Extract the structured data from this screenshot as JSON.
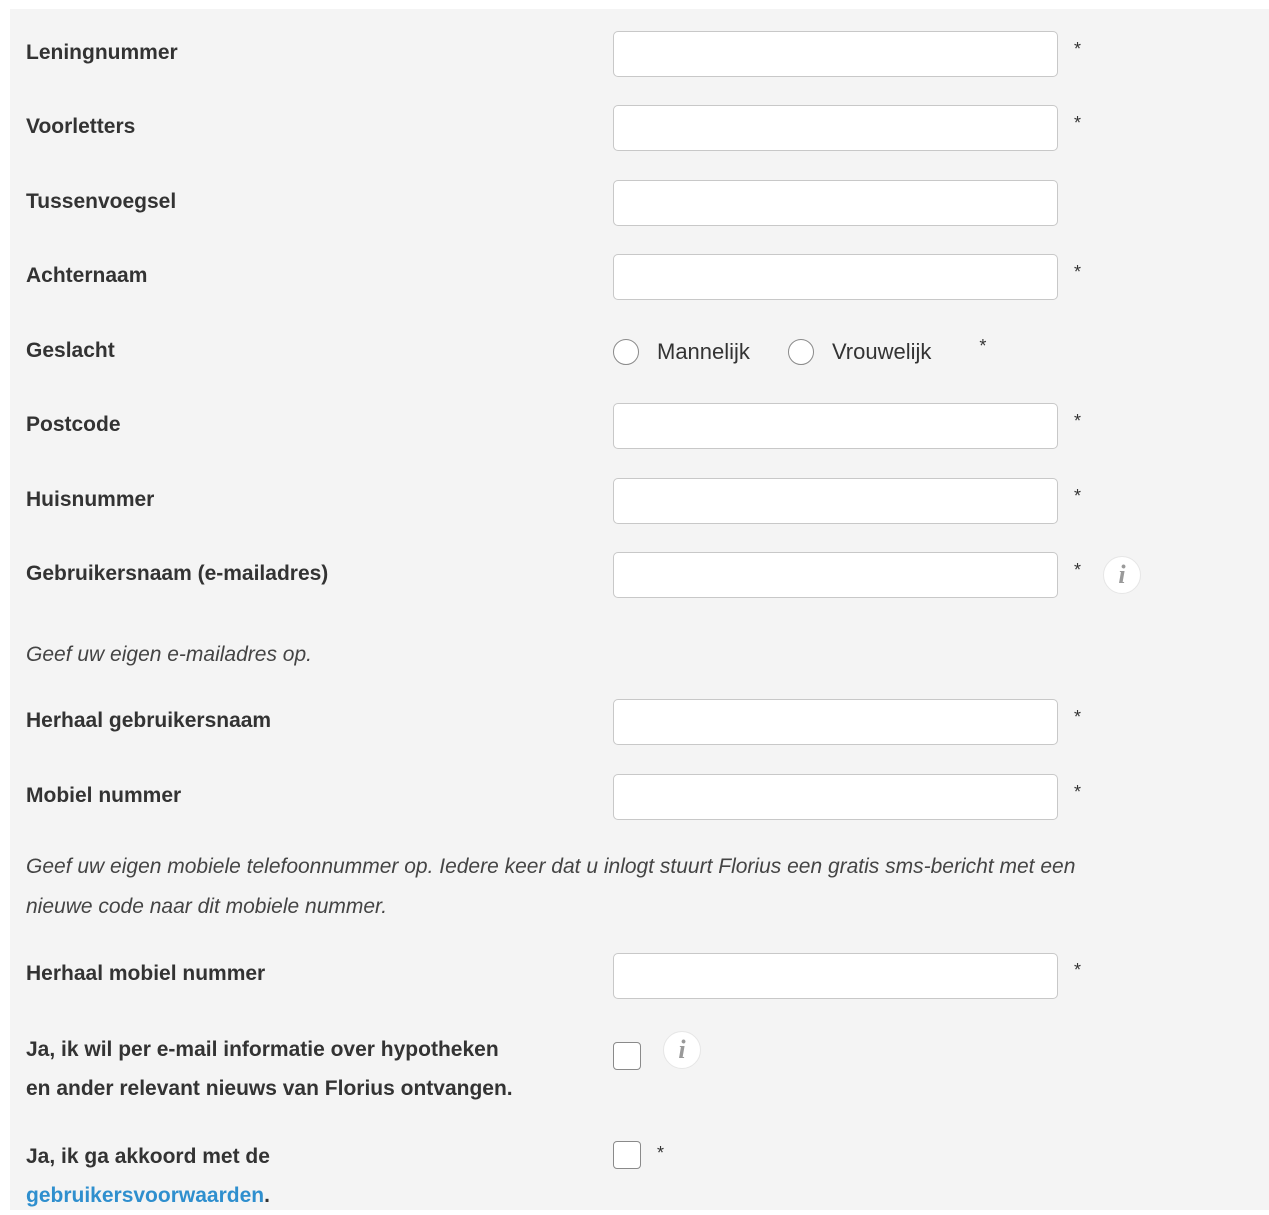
{
  "form": {
    "required_marker": "*",
    "fields": {
      "leningnummer": {
        "label": "Leningnummer",
        "value": ""
      },
      "voorletters": {
        "label": "Voorletters",
        "value": ""
      },
      "tussenvoegsel": {
        "label": "Tussenvoegsel",
        "value": ""
      },
      "achternaam": {
        "label": "Achternaam",
        "value": ""
      },
      "postcode": {
        "label": "Postcode",
        "value": ""
      },
      "huisnummer": {
        "label": "Huisnummer",
        "value": ""
      },
      "gebruikersnaam": {
        "label": "Gebruikersnaam (e-mailadres)",
        "value": ""
      },
      "herhaal_gebruikersnaam": {
        "label": "Herhaal gebruikersnaam",
        "value": ""
      },
      "mobiel_nummer": {
        "label": "Mobiel nummer",
        "value": ""
      },
      "herhaal_mobiel_nummer": {
        "label": "Herhaal mobiel nummer",
        "value": ""
      }
    },
    "geslacht": {
      "label": "Geslacht",
      "options": [
        "Mannelijk",
        "Vrouwelijk"
      ],
      "selected": null
    },
    "hints": {
      "email": "Geef uw eigen e-mailadres op.",
      "mobile_line1": "Geef uw eigen mobiele telefoonnummer op. Iedere keer dat u inlogt stuurt Florius een gratis sms-bericht met een",
      "mobile_line2": "nieuwe code naar dit mobiele nummer."
    },
    "newsletter": {
      "label_line1": "Ja, ik wil per e-mail informatie over hypotheken",
      "label_line2": "en ander relevant nieuws van Florius ontvangen.",
      "checked": false
    },
    "terms": {
      "label_prefix": "Ja, ik ga akkoord met de",
      "link_text": "gebruikersvoorwaarden",
      "label_suffix": ".",
      "checked": false
    },
    "info_icon_glyph": "i"
  }
}
